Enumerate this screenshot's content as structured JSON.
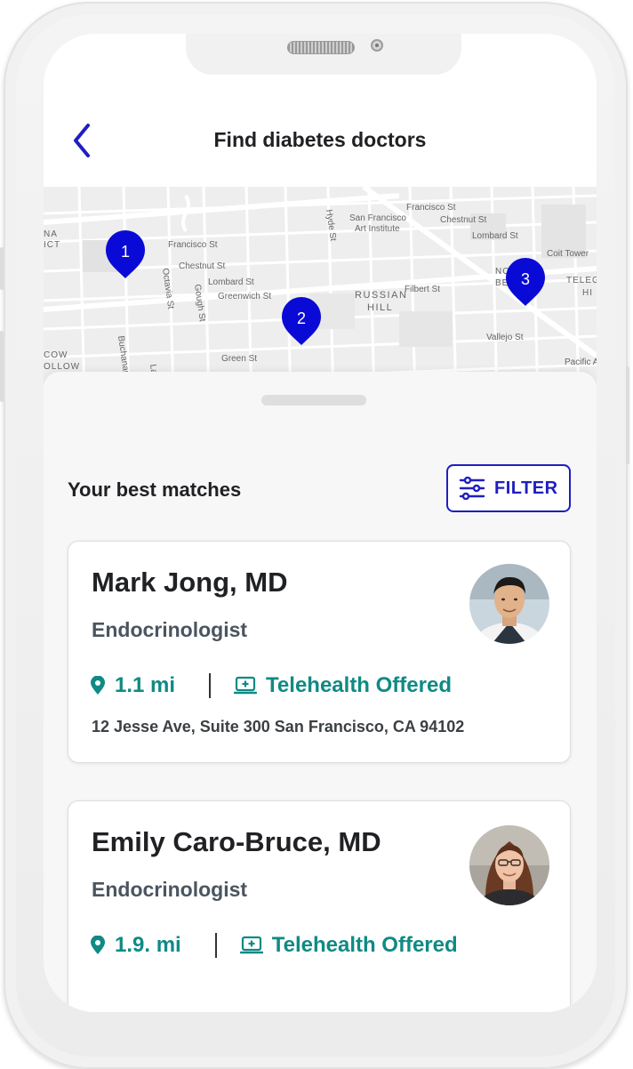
{
  "header": {
    "title": "Find diabetes doctors"
  },
  "map": {
    "labels": [
      "Francisco St",
      "Chestnut St",
      "Lombard St",
      "Greenwich St",
      "Octavia St",
      "Gough St",
      "Hyde St",
      "San Francisco",
      "Art Institute",
      "Francisco St",
      "Chestnut St",
      "Lombard St",
      "Coit Tower",
      "RUSSIAN",
      "HILL",
      "Filbert St",
      "Vallejo St",
      "Green St",
      "Buchanan St",
      "Pacific A",
      "COW",
      "OLLOW",
      "NA",
      "ICT",
      "TELEG",
      "HI",
      "NO",
      "BE",
      "Lag"
    ],
    "pins": [
      "1",
      "2",
      "3"
    ],
    "accent": "#0a0ad6"
  },
  "sheet": {
    "section_title": "Your best matches",
    "filter_label": "FILTER"
  },
  "doctors": [
    {
      "name": "Mark Jong, MD",
      "specialty": "Endocrinologist",
      "distance": "1.1 mi",
      "telehealth": "Telehealth Offered",
      "address": "12 Jesse Ave, Suite 300  San Francisco, CA 94102"
    },
    {
      "name": "Emily Caro-Bruce, MD",
      "specialty": "Endocrinologist",
      "distance": "1.9. mi",
      "telehealth": "Telehealth Offered"
    }
  ],
  "colors": {
    "brand": "#1f1fbf",
    "teal": "#0f8a84"
  }
}
